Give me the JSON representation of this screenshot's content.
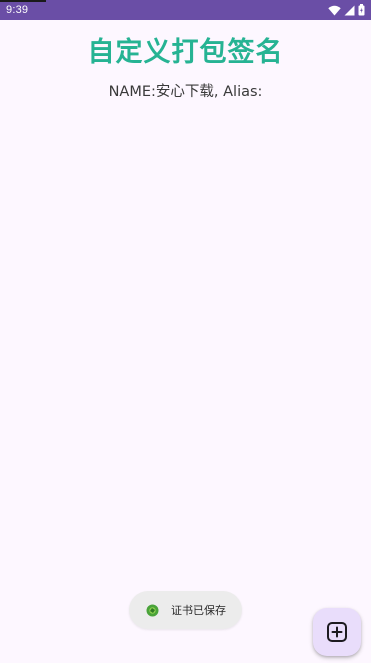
{
  "status_bar": {
    "time": "9:39",
    "icons": [
      "wifi-icon",
      "signal-icon",
      "battery-icon"
    ]
  },
  "title": "自定义打包签名",
  "sign_info": "NAME:安心下载, Alias:",
  "toast": {
    "icon": "app-icon",
    "message": "证书已保存"
  },
  "fab": {
    "icon": "add-box-icon"
  },
  "colors": {
    "status_bar": "#6a4ea6",
    "title": "#26b393",
    "background": "#fdf7ff",
    "fab": "#e9ddfb",
    "toast": "#ececec"
  }
}
